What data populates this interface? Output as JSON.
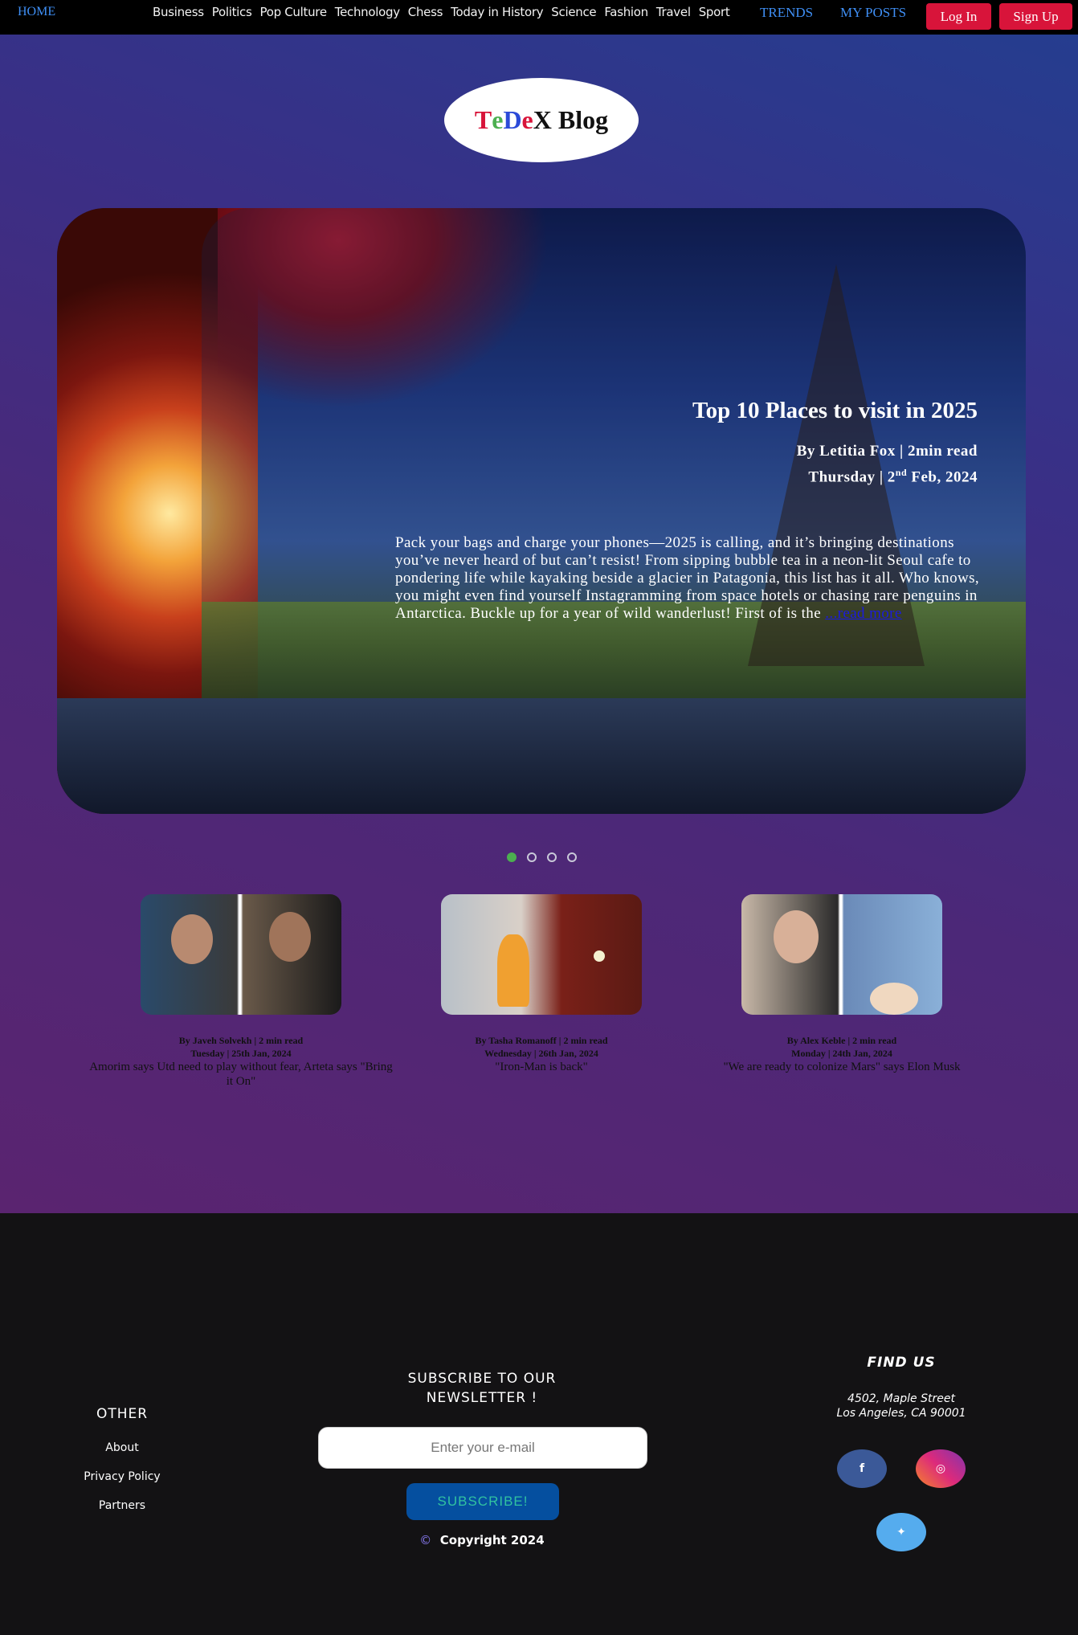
{
  "nav": {
    "home": "HOME",
    "links": [
      "Business",
      "Politics",
      "Pop Culture",
      "Technology",
      "Chess",
      "Today in History",
      "Science",
      "Fashion",
      "Travel",
      "Sport"
    ],
    "trends": "TRENDS",
    "my_posts": "MY POSTS",
    "login": "Log In",
    "signup": "Sign Up"
  },
  "logo": {
    "part1": "T",
    "part2": "e",
    "part3": "D",
    "part4": "e",
    "part5": "X",
    "part6": " Blog"
  },
  "hero": {
    "title": "Top 10 Places to visit in 2025",
    "author_line": "By Letitia Fox | 2min read",
    "date_prefix": "Thursday | 2",
    "date_sup": "nd",
    "date_suffix": " Feb, 2024",
    "text": "Pack your bags and charge your phones—2025 is calling, and it’s bringing destinations you’ve never heard of but can’t resist! From sipping bubble tea in a neon-lit Seoul cafe to pondering life while kayaking beside a glacier in Patagonia, this list has it all. Who knows, you might even find yourself Instagramming from space hotels or chasing rare penguins in Antarctica. Buckle up for a year of wild wanderlust! First of is the ",
    "read_more": "...read more"
  },
  "slider": {
    "count": 4,
    "active": 0
  },
  "cards": [
    {
      "byline": "By Javeh Solvekh | 2 min read",
      "date": "Tuesday | 25th Jan, 2024",
      "headline": "Amorim says Utd need to play without fear, Arteta says \"Bring it On\""
    },
    {
      "byline": "By Tasha Romanoff | 2 min read",
      "date": "Wednesday | 26th Jan, 2024",
      "headline": "\"Iron-Man is back\""
    },
    {
      "byline": "By Alex Keble | 2 min read",
      "date": "Monday | 24th Jan, 2024",
      "headline": "\"We are ready to colonize Mars\" says Elon Musk"
    }
  ],
  "footer": {
    "other_title": "OTHER",
    "other_links": [
      "About",
      "Privacy Policy",
      "Partners"
    ],
    "newsletter_title": "SUBSCRIBE TO OUR\nNEWSLETTER !",
    "email_placeholder": "Enter your e-mail",
    "subscribe": "SUBSCRIBE!",
    "copyright_symbol": "©",
    "copyright": "Copyright 2024",
    "find_us": "FIND US",
    "address_line1": "4502, Maple Street",
    "address_line2": "Los Angeles, CA 90001",
    "social": {
      "facebook": "f",
      "instagram": "◎",
      "twitter": "✦"
    }
  },
  "colors": {
    "accent_red": "#d8143a",
    "link_blue": "#3f8ff5",
    "active_dot": "#4caf50"
  }
}
